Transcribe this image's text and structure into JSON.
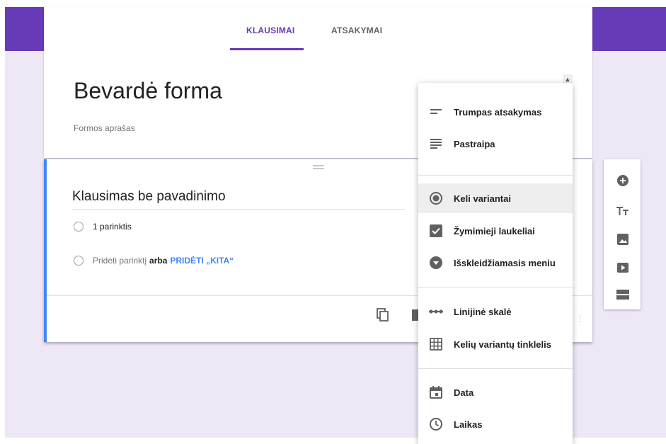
{
  "tabs": {
    "questions": "KLAUSIMAI",
    "responses": "ATSAKYMAI"
  },
  "form": {
    "title": "Bevardė forma",
    "description": "Formos aprašas"
  },
  "question": {
    "title": "Klausimas be pavadinimo",
    "option1": "1 parinktis",
    "add_option": "Pridėti parinktį",
    "or": "arba",
    "add_other": "PRIDĖTI „KITA“"
  },
  "dropdown": {
    "short_answer": "Trumpas atsakymas",
    "paragraph": "Pastraipa",
    "multiple_choice": "Keli variantai",
    "checkboxes": "Žymimieji laukeliai",
    "dropdown_menu": "Išskleidžiamasis meniu",
    "linear_scale": "Linijinė skalė",
    "grid": "Kelių variantų tinklelis",
    "date": "Data",
    "time": "Laikas",
    "selected": "Keli variantai"
  },
  "colors": {
    "accent": "#673ab7",
    "background": "#ede7f6",
    "link": "#4285f4"
  },
  "icons": {
    "sidebar": [
      "add-circle-icon",
      "title-icon",
      "image-icon",
      "video-icon",
      "section-icon"
    ]
  }
}
